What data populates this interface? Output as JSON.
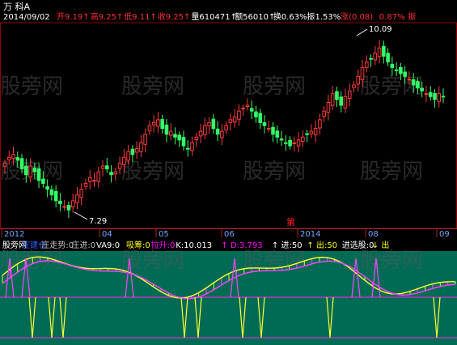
{
  "header": {
    "stock": "万 科A",
    "date": "2014/09/02",
    "fields": [
      {
        "label": "开",
        "value": "9.19",
        "arrow": "↑",
        "color": "#ff3030"
      },
      {
        "label": "高",
        "value": "9.25",
        "arrow": "↑",
        "color": "#ff3030"
      },
      {
        "label": "低",
        "value": "9.11",
        "arrow": "↑",
        "color": "#ff3030"
      },
      {
        "label": "收",
        "value": "9.25",
        "arrow": "↑",
        "color": "#ff3030"
      },
      {
        "label": "量",
        "value": "610471",
        "arrow": "↑",
        "color": "#ffffff"
      },
      {
        "label": "额",
        "value": "56010",
        "arrow": "↑",
        "color": "#ffffff"
      },
      {
        "label": "换",
        "value": "0.63%",
        "arrow": "",
        "color": "#ffffff"
      },
      {
        "label": "振",
        "value": "1.53%",
        "arrow": "",
        "color": "#ffffff"
      },
      {
        "label": "涨",
        "value": "(0.08)",
        "arrow": "",
        "color": "#ff3030"
      },
      {
        "label": "",
        "value": "0.87%",
        "arrow": "",
        "color": "#ff3030"
      },
      {
        "label": "振",
        "value": "",
        "arrow": "",
        "color": "#ff3030"
      }
    ]
  },
  "annotations": {
    "high": "10.09",
    "low": "7.29",
    "marker": "第"
  },
  "time_axis": [
    "2012",
    "04",
    "05",
    "06",
    "2014",
    "08",
    "09"
  ],
  "indicator_header": [
    {
      "text": "股旁网",
      "color": "#ffffff"
    },
    {
      "text": "庄建仓",
      "color": "#3060ff"
    },
    {
      "text": "庄走势:0",
      "color": "#c0c0c0"
    },
    {
      "text": "庄进:0",
      "color": "#c0c0c0"
    },
    {
      "text": "VA9:0",
      "color": "#ffffff"
    },
    {
      "text": "吸筹:0",
      "color": "#ffff00"
    },
    {
      "text": "拉升:0",
      "color": "#ff00ff"
    },
    {
      "text": "K:10.013",
      "color": "#ffffff"
    },
    {
      "text": "↑ D:3.793",
      "color": "#ff00ff"
    },
    {
      "text": "↑ 进:50",
      "color": "#ffffff"
    },
    {
      "text": "↑ 出:50",
      "color": "#ffff00"
    },
    {
      "text": "进选股:0",
      "color": "#ffffff"
    },
    {
      "text": "↓ 出",
      "color": "#ffff00"
    }
  ],
  "watermarks": [
    "股旁网",
    "股旁网",
    "股旁网",
    "股旁网",
    "股旁网",
    "股旁网",
    "股旁网",
    "股旁网",
    "股旁网",
    "股旁网",
    "股旁网",
    "股旁网"
  ],
  "chart_data": {
    "type": "candlestick",
    "price_range": [
      7.0,
      10.5
    ],
    "series": [
      {
        "name": "close",
        "values": [
          8.1,
          8.2,
          8.25,
          8.15,
          8.0,
          7.9,
          8.05,
          7.95,
          7.8,
          7.75,
          7.65,
          7.55,
          7.45,
          7.4,
          7.35,
          7.29,
          7.45,
          7.55,
          7.65,
          7.75,
          7.85,
          7.8,
          7.95,
          8.05,
          8.0,
          7.9,
          7.95,
          8.1,
          8.2,
          8.3,
          8.25,
          8.35,
          8.45,
          8.6,
          8.75,
          8.8,
          8.85,
          8.7,
          8.6,
          8.65,
          8.55,
          8.5,
          8.4,
          8.35,
          8.45,
          8.55,
          8.65,
          8.75,
          8.8,
          8.7,
          8.6,
          8.65,
          8.75,
          8.85,
          8.9,
          9.0,
          9.05,
          9.1,
          9.0,
          8.9,
          8.8,
          8.75,
          8.7,
          8.6,
          8.55,
          8.5,
          8.45,
          8.4,
          8.45,
          8.5,
          8.55,
          8.6,
          8.65,
          8.7,
          8.85,
          9.0,
          9.15,
          9.3,
          9.2,
          9.1,
          9.25,
          9.35,
          9.45,
          9.6,
          9.75,
          9.85,
          9.9,
          10.0,
          10.09,
          9.95,
          9.85,
          9.75,
          9.7,
          9.65,
          9.6,
          9.55,
          9.45,
          9.4,
          9.35,
          9.3,
          9.25,
          9.2,
          9.3,
          9.25
        ]
      }
    ],
    "indicator_levels": {
      "upper": 0.8,
      "lower": 0.15
    }
  }
}
